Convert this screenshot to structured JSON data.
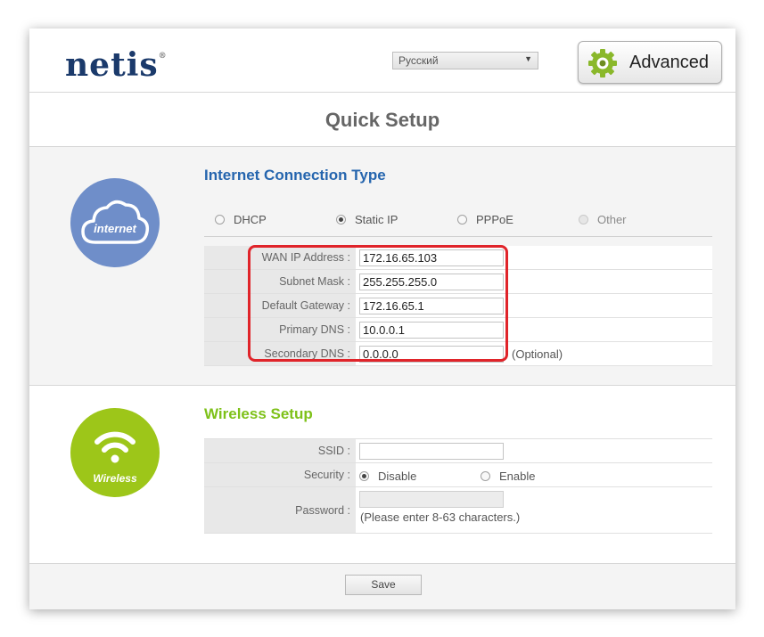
{
  "header": {
    "logo": "netis",
    "logo_mark": "®",
    "language": {
      "selected": "Русский"
    },
    "advanced_label": "Advanced"
  },
  "page_title": "Quick Setup",
  "internet": {
    "icon_label": "internet",
    "title": "Internet Connection Type",
    "modes": [
      {
        "label": "DHCP",
        "selected": false
      },
      {
        "label": "Static IP",
        "selected": true
      },
      {
        "label": "PPPoE",
        "selected": false
      },
      {
        "label": "Other",
        "selected": false
      }
    ],
    "fields": [
      {
        "label": "WAN IP Address :",
        "value": "172.16.65.103"
      },
      {
        "label": "Subnet Mask :",
        "value": "255.255.255.0"
      },
      {
        "label": "Default Gateway :",
        "value": "172.16.65.1"
      },
      {
        "label": "Primary DNS :",
        "value": "10.0.0.1"
      },
      {
        "label": "Secondary DNS :",
        "value": "0.0.0.0",
        "note": "(Optional)"
      }
    ]
  },
  "wireless": {
    "icon_label": "Wireless",
    "title": "Wireless Setup",
    "ssid": {
      "label": "SSID :",
      "value": ""
    },
    "security": {
      "label": "Security :",
      "options": [
        {
          "label": "Disable",
          "selected": true
        },
        {
          "label": "Enable",
          "selected": false
        }
      ]
    },
    "password": {
      "label": "Password :",
      "value": "",
      "hint": "(Please enter 8-63 characters.)"
    }
  },
  "footer": {
    "save_label": "Save"
  },
  "colors": {
    "internet_icon": "#6f8ec9",
    "wireless_icon": "#9dc619",
    "highlight": "#e0242a",
    "title_blue": "#2565ae",
    "title_green": "#7ec119"
  }
}
